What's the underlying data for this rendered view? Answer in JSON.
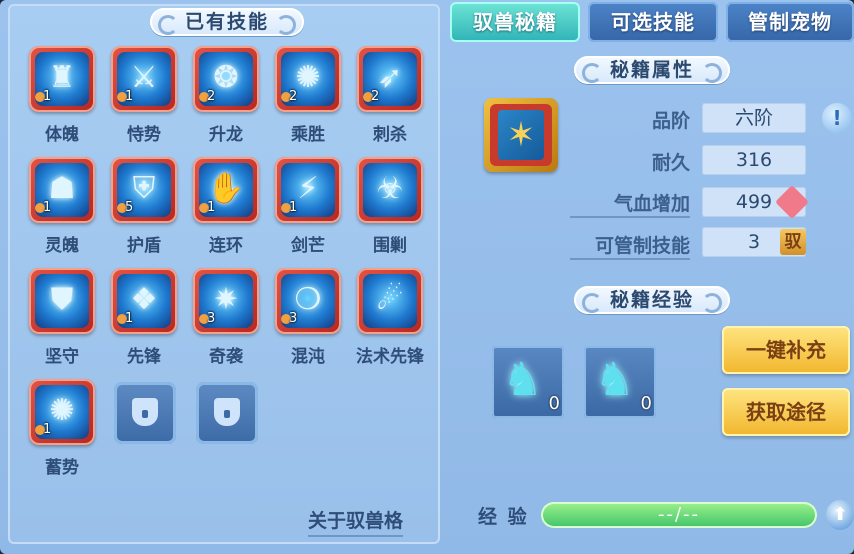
{
  "left_panel": {
    "title": "已有技能",
    "skills": [
      {
        "name": "体魄",
        "level": "1",
        "icon": "golden-armor-icon"
      },
      {
        "name": "恃势",
        "level": "1",
        "icon": "shield-blade-icon"
      },
      {
        "name": "升龙",
        "level": "2",
        "icon": "dragon-icon"
      },
      {
        "name": "乘胜",
        "level": "2",
        "icon": "swirl-icon"
      },
      {
        "name": "刺杀",
        "level": "2",
        "icon": "assassin-icon"
      },
      {
        "name": "灵魄",
        "level": "1",
        "icon": "spirit-icon"
      },
      {
        "name": "护盾",
        "level": "5",
        "icon": "shield-icon"
      },
      {
        "name": "连环",
        "level": "1",
        "icon": "claw-icon"
      },
      {
        "name": "剑芒",
        "level": "1",
        "icon": "sword-light-icon"
      },
      {
        "name": "围剿",
        "level": "",
        "icon": "beast-icon"
      },
      {
        "name": "坚守",
        "level": "",
        "icon": "guard-shield-icon"
      },
      {
        "name": "先锋",
        "level": "1",
        "icon": "crystal-icon"
      },
      {
        "name": "奇袭",
        "level": "3",
        "icon": "shatter-icon"
      },
      {
        "name": "混沌",
        "level": "3",
        "icon": "bubbles-icon"
      },
      {
        "name": "法术先锋",
        "level": "",
        "icon": "magic-comet-icon"
      },
      {
        "name": "蓄势",
        "level": "1",
        "icon": "vortex-icon"
      }
    ],
    "about_link": "关于驭兽格"
  },
  "tabs": [
    {
      "label": "驭兽秘籍",
      "active": true
    },
    {
      "label": "可选技能",
      "active": false
    },
    {
      "label": "管制宠物",
      "active": false
    }
  ],
  "attributes": {
    "title": "秘籍属性",
    "grade_label": "品阶",
    "grade_value": "六阶",
    "durability_label": "耐久",
    "durability_value": "316",
    "hp_label": "气血增加",
    "hp_value": "499",
    "control_label": "可管制技能",
    "control_value": "3",
    "control_badge": "驭"
  },
  "experience": {
    "title": "秘籍经验",
    "items": [
      {
        "count": "0",
        "icon": "blue-horse-icon"
      },
      {
        "count": "0",
        "icon": "blue-horse-icon"
      }
    ],
    "refill_button": "一键补充",
    "source_button": "获取途径",
    "exp_label": "经 验",
    "exp_value": "--/--"
  }
}
